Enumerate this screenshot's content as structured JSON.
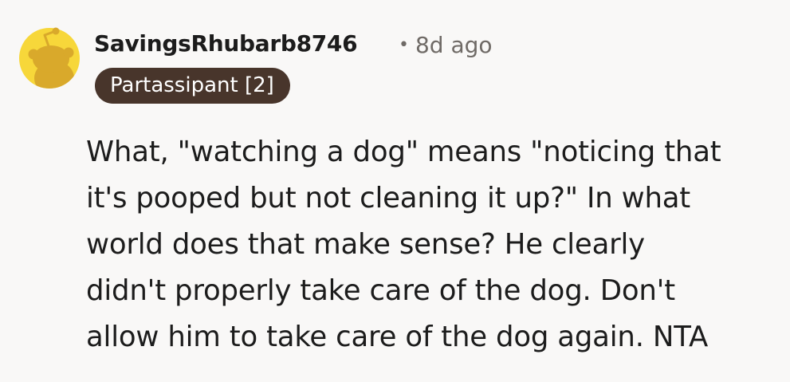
{
  "comment": {
    "avatar_icon": "snoo-avatar-icon",
    "avatar_color": "#f7d73a",
    "author": "SavingsRhubarb8746",
    "separator": "•",
    "age": "8d ago",
    "flair": "Partassipant [2]",
    "flair_color": "#48352b",
    "body_lines": [
      "What, \"watching a dog\" means \"noticing that",
      "it's pooped but not cleaning it up?\" In what",
      "world does that make sense? He clearly",
      "didn't properly take care of the dog. Don't",
      "allow him to take care of the dog again. NTA"
    ]
  }
}
